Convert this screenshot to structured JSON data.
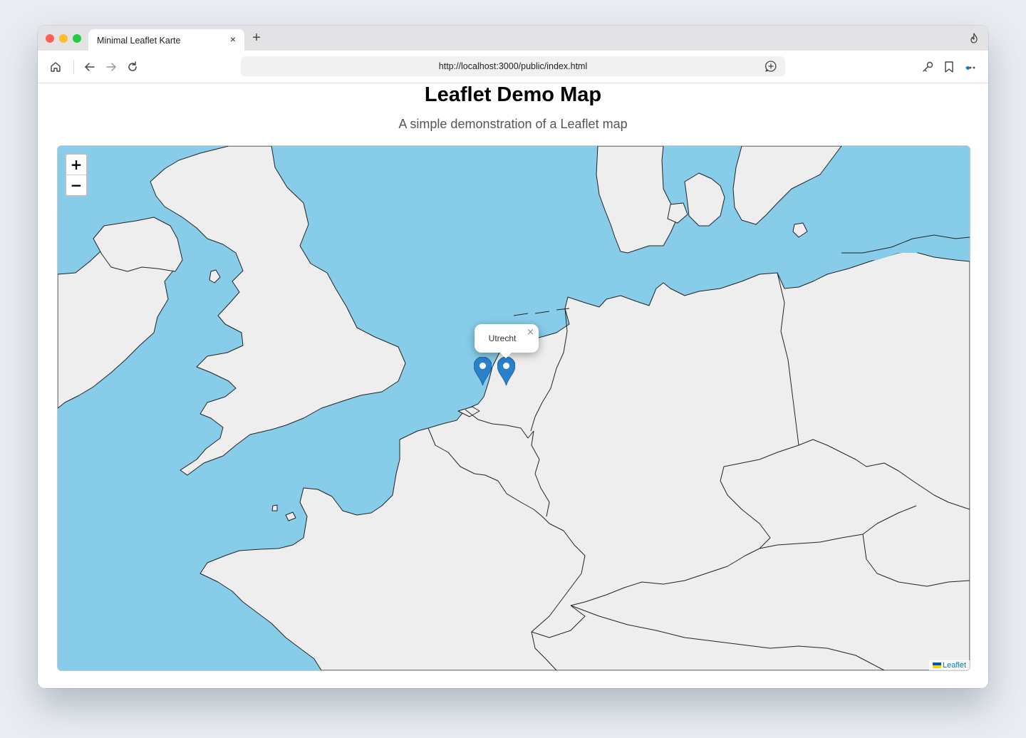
{
  "browser": {
    "tab_title": "Minimal Leaflet Karte",
    "tab_close": "×",
    "new_tab": "+",
    "url": "http://localhost:3000/public/index.html"
  },
  "page": {
    "title": "Leaflet Demo Map",
    "subtitle": "A simple demonstration of a Leaflet map"
  },
  "map": {
    "zoom_in": "+",
    "zoom_out": "−",
    "popup_text": "Utrecht",
    "popup_close": "×",
    "attribution": "Leaflet",
    "water_color": "#87cdea",
    "land_color": "#eeeeee",
    "marker_color": "#2a81cb"
  }
}
